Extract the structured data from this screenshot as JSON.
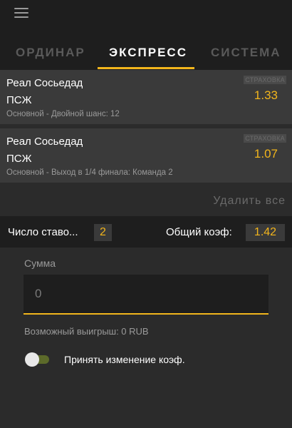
{
  "tabs": {
    "single": "ОРДИНАР",
    "express": "ЭКСПРЕСС",
    "system": "СИСТЕМА"
  },
  "bets": [
    {
      "team1": "Реал Сосьедад",
      "team2": "ПСЖ",
      "description": "Основной - Двойной шанс: 12",
      "badge": "СТРАХОВКА",
      "coef": "1.33"
    },
    {
      "team1": "Реал Сосьедад",
      "team2": "ПСЖ",
      "description": "Основной - Выход в 1/4 финала: Команда 2",
      "badge": "СТРАХОВКА",
      "coef": "1.07"
    }
  ],
  "delete_all": "Удалить все",
  "summary": {
    "count_label": "Число ставо...",
    "count_value": "2",
    "total_label": "Общий коэф:",
    "total_value": "1.42"
  },
  "stake": {
    "label": "Сумма",
    "placeholder": "0"
  },
  "possible_win": "Возможный выигрыш: 0 RUB",
  "accept_changes": "Принять изменение коэф.",
  "colors": {
    "accent": "#f2b51c",
    "background": "#2b2b2b",
    "panel": "#3a3a3a",
    "dark": "#1e1e1e"
  }
}
